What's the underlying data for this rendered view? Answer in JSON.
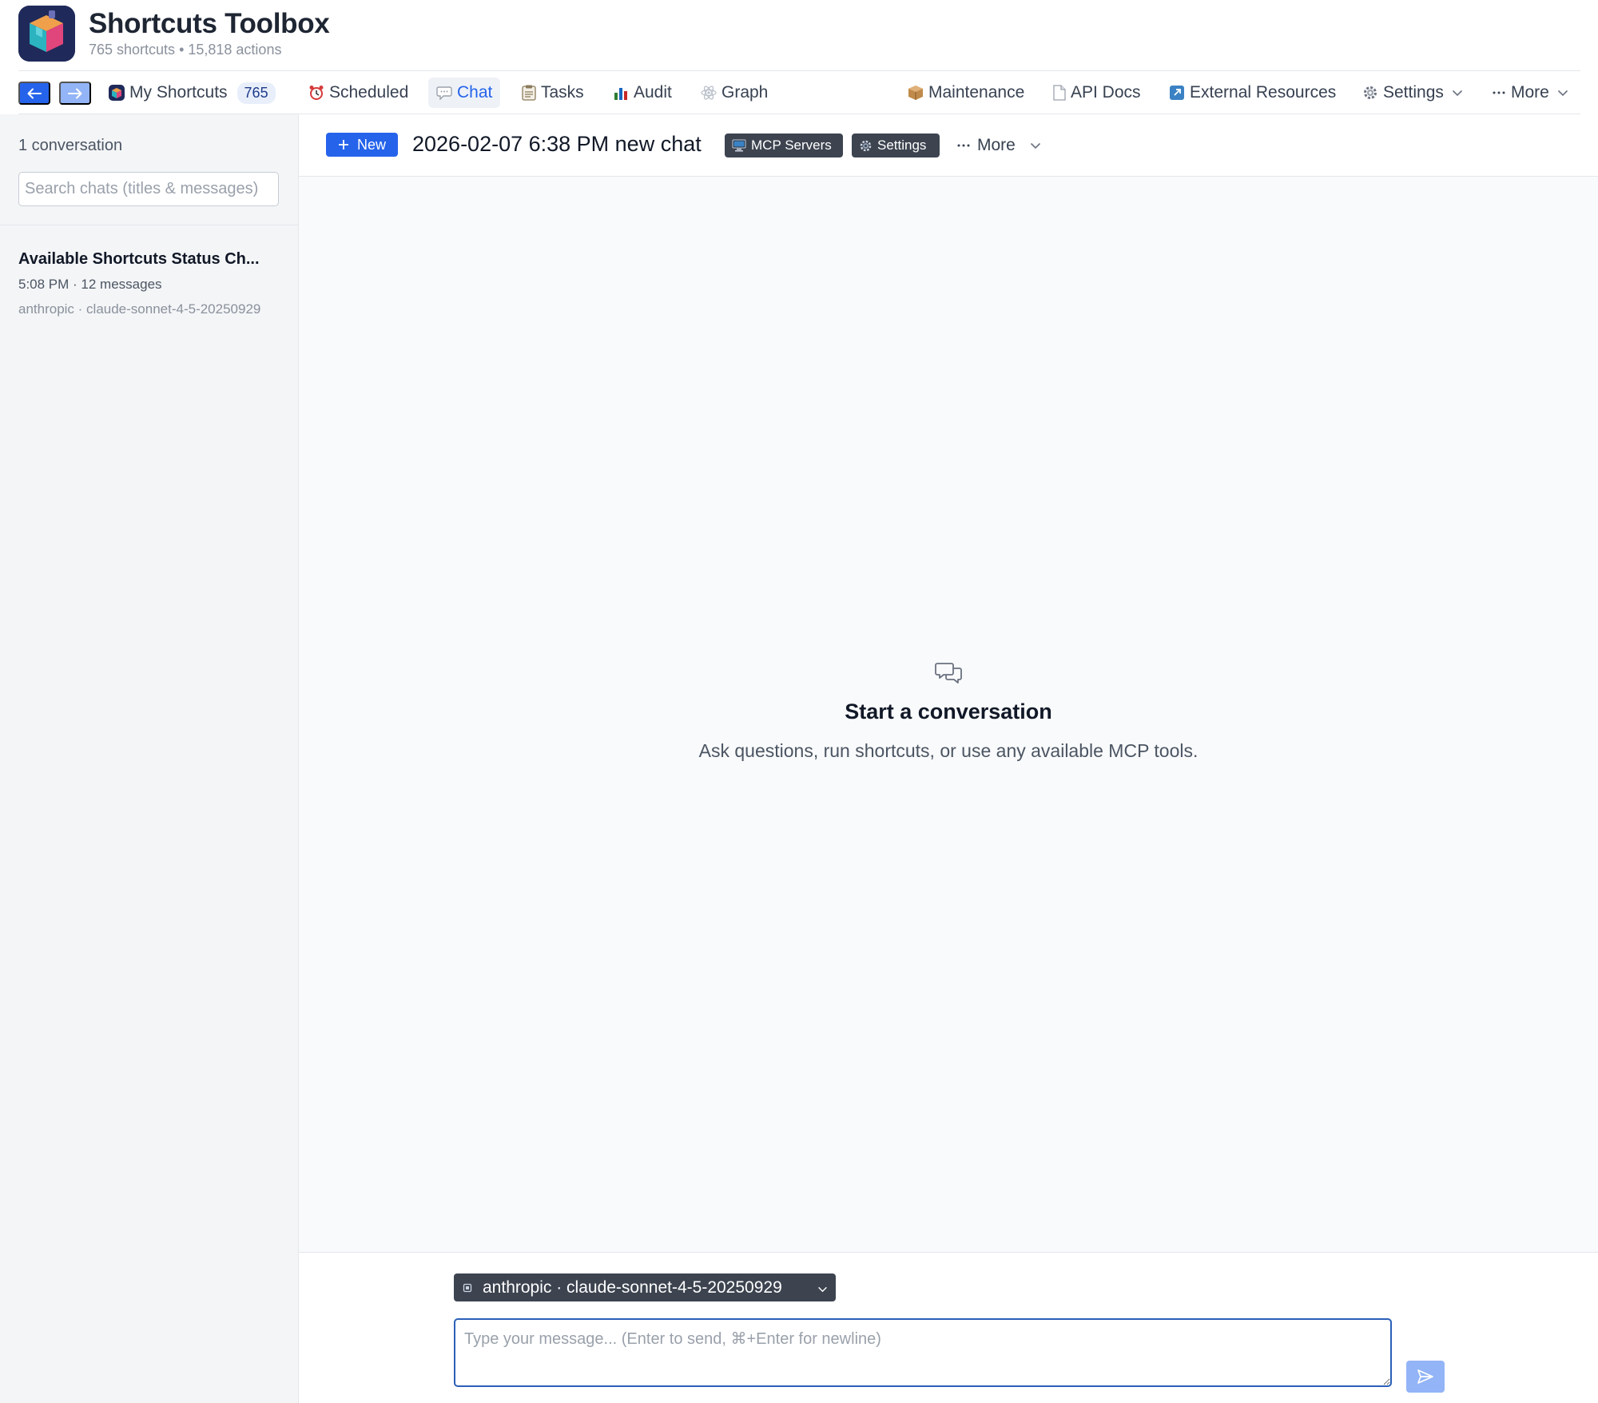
{
  "app": {
    "title": "Shortcuts Toolbox",
    "subtitle": "765 shortcuts • 15,818 actions",
    "accent_color": "#2563eb"
  },
  "nav": {
    "back_icon": "arrow-left-icon",
    "forward_icon": "arrow-right-icon",
    "items": [
      {
        "label": "My Shortcuts",
        "icon": "shortcuts-app-icon",
        "badge": "765"
      },
      {
        "label": "Scheduled",
        "icon": "alarm-clock-icon"
      },
      {
        "label": "Chat",
        "icon": "speech-bubble-icon",
        "active": true
      },
      {
        "label": "Tasks",
        "icon": "clipboard-icon"
      },
      {
        "label": "Audit",
        "icon": "bar-chart-icon"
      },
      {
        "label": "Graph",
        "icon": "atom-icon"
      },
      {
        "label": "Maintenance",
        "icon": "package-icon"
      },
      {
        "label": "API Docs",
        "icon": "document-icon"
      },
      {
        "label": "External Resources",
        "icon": "external-link-icon"
      },
      {
        "label": "Settings",
        "icon": "gear-icon",
        "dropdown": true
      },
      {
        "label": "More",
        "icon": "ellipsis-icon",
        "dropdown": true
      }
    ]
  },
  "sidebar": {
    "count_label": "1 conversation",
    "search_placeholder": "Search chats (titles & messages)",
    "conversations": [
      {
        "title": "Available Shortcuts Status Ch...",
        "meta": "5:08 PM · 12 messages",
        "model": "anthropic · claude-sonnet-4-5-20250929"
      }
    ]
  },
  "toolbar": {
    "new_label": "New",
    "chat_title": "2026-02-07 6:38 PM new chat",
    "mcp_label": "MCP Servers",
    "settings_label": "Settings",
    "more_label": "More"
  },
  "empty_state": {
    "icon": "chat-bubbles-icon",
    "title": "Start a conversation",
    "description": "Ask questions, run shortcuts, or use any available MCP tools."
  },
  "composer": {
    "model_label": "anthropic · claude-sonnet-4-5-20250929",
    "model_icon": "chip-icon",
    "input_value": "",
    "input_placeholder": "Type your message... (Enter to send, ⌘+Enter for newline)",
    "send_icon": "send-icon"
  }
}
